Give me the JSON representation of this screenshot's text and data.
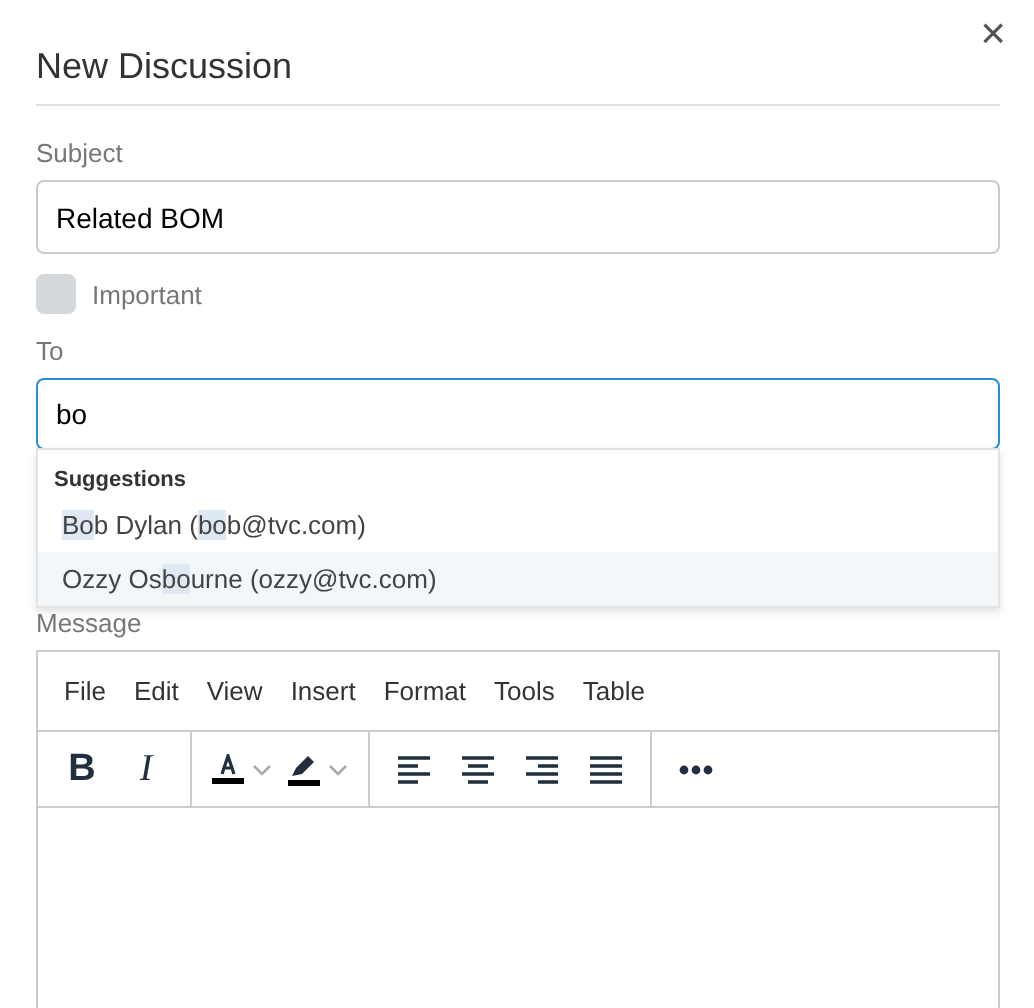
{
  "dialog": {
    "title": "New Discussion",
    "close": "×"
  },
  "subject": {
    "label": "Subject",
    "value": "Related BOM"
  },
  "important": {
    "label": "Important",
    "checked": false
  },
  "to": {
    "label": "To",
    "value": "bo"
  },
  "suggestions": {
    "heading": "Suggestions",
    "items": [
      {
        "parts": [
          {
            "text": "Bo",
            "match": true
          },
          {
            "text": "b Dylan (",
            "match": false
          },
          {
            "text": "bo",
            "match": true
          },
          {
            "text": "b@tvc.com)",
            "match": false
          }
        ],
        "selected": false
      },
      {
        "parts": [
          {
            "text": "Ozzy Os",
            "match": false
          },
          {
            "text": "bo",
            "match": true
          },
          {
            "text": "urne (ozzy@tvc.com)",
            "match": false
          }
        ],
        "selected": true
      }
    ]
  },
  "message": {
    "label": "Message",
    "menu": [
      "File",
      "Edit",
      "View",
      "Insert",
      "Format",
      "Tools",
      "Table"
    ],
    "toolbar": [
      [
        {
          "kind": "bold",
          "text": "B"
        },
        {
          "kind": "italic",
          "text": "I"
        }
      ],
      [
        {
          "kind": "forecolor"
        },
        {
          "kind": "backcolor"
        }
      ],
      [
        {
          "kind": "alignleft"
        },
        {
          "kind": "aligncenter"
        },
        {
          "kind": "alignright"
        },
        {
          "kind": "alignjustify"
        }
      ],
      [
        {
          "kind": "more"
        }
      ]
    ]
  }
}
